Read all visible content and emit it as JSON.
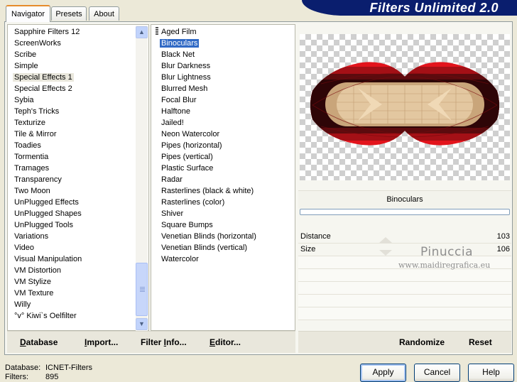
{
  "window_title": "Filters Unlimited 2.0",
  "tabs": [
    {
      "label": "Navigator",
      "active": true
    },
    {
      "label": "Presets",
      "active": false
    },
    {
      "label": "About",
      "active": false
    }
  ],
  "categories": [
    "Sapphire Filters 12",
    "ScreenWorks",
    "Scribe",
    "Simple",
    "Special Effects 1",
    "Special Effects 2",
    "Sybia",
    "Teph's Tricks",
    "Texturize",
    "Tile & Mirror",
    "Toadies",
    "Tormentia",
    "Tramages",
    "Transparency",
    "Two Moon",
    "UnPlugged Effects",
    "UnPlugged Shapes",
    "UnPlugged Tools",
    "Variations",
    "Video",
    "Visual Manipulation",
    "VM Distortion",
    "VM Stylize",
    "VM Texture",
    "Willy",
    "°v° Kiwi`s Oelfilter"
  ],
  "selected_category": "Special Effects 1",
  "filters": [
    "Aged Film",
    "Binoculars",
    "Black Net",
    "Blur Darkness",
    "Blur Lightness",
    "Blurred Mesh",
    "Focal Blur",
    "Halftone",
    "Jailed!",
    "Neon Watercolor",
    "Pipes (horizontal)",
    "Pipes (vertical)",
    "Plastic Surface",
    "Radar",
    "Rasterlines (black & white)",
    "Rasterlines (color)",
    "Shiver",
    "Square Bumps",
    "Venetian Blinds (horizontal)",
    "Venetian Blinds (vertical)",
    "Watercolor"
  ],
  "selected_filter": "Binoculars",
  "filter_label": "Binoculars",
  "parameters": [
    {
      "name": "Distance",
      "value": "103"
    },
    {
      "name": "Size",
      "value": "106"
    }
  ],
  "watermark": {
    "signature": "Pinuccia",
    "url": "www.maidiregrafica.eu"
  },
  "left_buttons": {
    "database": {
      "first": "D",
      "rest": "atabase"
    },
    "import": {
      "first": "I",
      "rest": "mport..."
    },
    "filter_info": {
      "first": "Filter ",
      "under": "I",
      "rest": "nfo..."
    },
    "editor": {
      "first": "E",
      "rest": "ditor..."
    }
  },
  "right_buttons": {
    "randomize": "Randomize",
    "reset": "Reset"
  },
  "info": {
    "database_label": "Database:",
    "database_value": "ICNET-Filters",
    "filters_label": "Filters:",
    "filters_value": "895"
  },
  "dialog_buttons": {
    "apply": "Apply",
    "cancel": "Cancel",
    "help": "Help"
  },
  "colors": {
    "selection": "#316AC5",
    "title_bg": "#0A1E6E",
    "panel_bg": "#ECE9D8"
  }
}
